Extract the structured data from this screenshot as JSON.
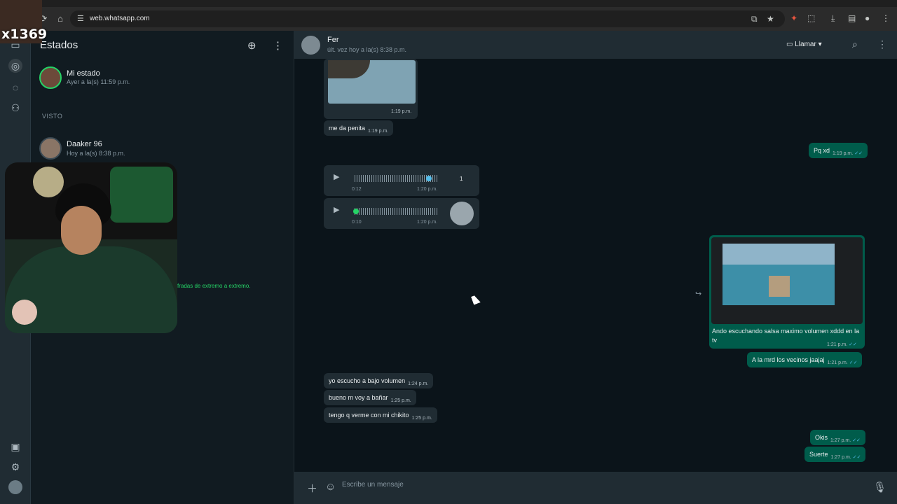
{
  "browser": {
    "url": "web.whatsapp.com"
  },
  "rail": {
    "icons": [
      "chats-icon",
      "status-icon",
      "channels-icon",
      "communities-icon",
      "media-icon",
      "settings-icon",
      "profile-avatar"
    ]
  },
  "status_panel": {
    "title": "Estados",
    "my_status": {
      "name": "Mi estado",
      "time": "Ayer a la(s) 11:59 p.m."
    },
    "seen_label": "VISTO",
    "contacts": [
      {
        "name": "Daaker 96",
        "time": "Hoy a la(s) 8:38 p.m."
      }
    ],
    "e2e_note": "fradas de extremo a extremo."
  },
  "overlay": {
    "watermark": "x1369"
  },
  "chat": {
    "contact_name": "Fer",
    "last_seen": "últ. vez hoy a la(s) 8:38 p.m.",
    "call_label": "Llamar",
    "image1_time": "1:19 p.m.",
    "messages": {
      "m1": {
        "text": "me da penita",
        "time": "1:19 p.m."
      },
      "m2": {
        "text": "Pq xd",
        "time": "1:19 p.m."
      },
      "m3": {
        "text": "Ando escuchando salsa maximo volumen xddd en la tv",
        "time": "1:21 p.m."
      },
      "m4": {
        "text": "A la mrd los vecinos jaajaj",
        "time": "1:21 p.m."
      },
      "m5": {
        "text": "yo escucho a bajo volumen",
        "time": "1:24 p.m."
      },
      "m6": {
        "text": "bueno m voy a bañar",
        "time": "1:25 p.m."
      },
      "m7": {
        "text": "tengo q verme con mi chikito",
        "time": "1:25 p.m."
      },
      "m8": {
        "text": "Okis",
        "time": "1:27 p.m."
      },
      "m9": {
        "text": "Suerte",
        "time": "1:27 p.m."
      }
    },
    "audio1": {
      "duration": "0:12",
      "time": "1:20 p.m.",
      "speed": "1"
    },
    "audio2": {
      "duration": "0:10",
      "time": "1:20 p.m."
    },
    "composer_placeholder": "Escribe un mensaje"
  },
  "colors": {
    "accent": "#25d366",
    "outgoing_bubble": "#005c4b",
    "incoming_bubble": "#202c33",
    "read_tick": "#53bdeb"
  }
}
